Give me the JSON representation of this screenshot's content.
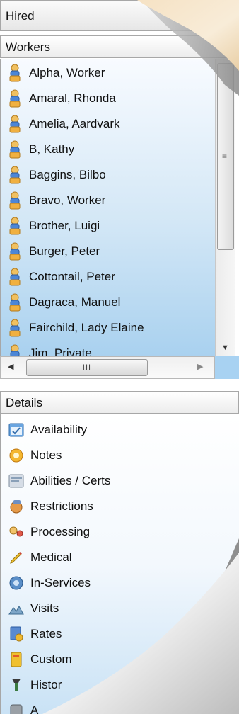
{
  "title": "Hired",
  "workers": {
    "header": "Workers",
    "items": [
      "Alpha, Worker",
      "Amaral, Rhonda",
      "Amelia, Aardvark",
      "B, Kathy",
      "Baggins, Bilbo",
      "Bravo, Worker",
      "Brother, Luigi",
      "Burger, Peter",
      "Cottontail, Peter",
      "Dagraca, Manuel",
      "Fairchild, Lady Elaine",
      "Jim, Private"
    ],
    "item_icon": "person-icon"
  },
  "vscroll": {
    "thumb_grip": "≡",
    "down_arrow": "▼"
  },
  "hscroll": {
    "left_arrow": "◀",
    "right_arrow": "▶",
    "thumb_grip": "III"
  },
  "details": {
    "header": "Details",
    "items": [
      {
        "label": "Availability",
        "icon": "calendar-icon"
      },
      {
        "label": "Notes",
        "icon": "notes-icon"
      },
      {
        "label": "Abilities / Certs",
        "icon": "certificate-icon"
      },
      {
        "label": "Restrictions",
        "icon": "restrictions-icon"
      },
      {
        "label": "Processing",
        "icon": "processing-icon"
      },
      {
        "label": "Medical",
        "icon": "pencil-icon"
      },
      {
        "label": "In-Services",
        "icon": "in-services-icon"
      },
      {
        "label": "Visits",
        "icon": "visits-icon"
      },
      {
        "label": "Rates",
        "icon": "rates-icon"
      },
      {
        "label": "Custom",
        "icon": "custom-icon"
      },
      {
        "label": "Histor",
        "icon": "history-icon"
      },
      {
        "label": "A",
        "icon": "partial-icon"
      }
    ]
  }
}
